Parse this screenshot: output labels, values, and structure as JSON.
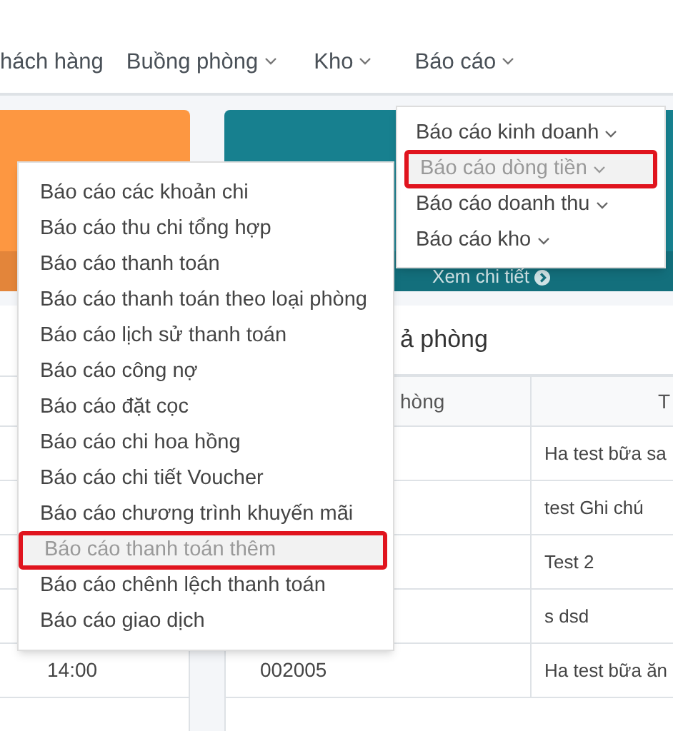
{
  "nav": [
    {
      "label": "hách hàng",
      "dropdown": false
    },
    {
      "label": "Buồng phòng",
      "dropdown": true
    },
    {
      "label": "Kho",
      "dropdown": true
    },
    {
      "label": "Báo cáo",
      "dropdown": true
    }
  ],
  "cards": {
    "link": "Xem chi tiết"
  },
  "left_table": {
    "cell": "14:00"
  },
  "right_table": {
    "title": "ả phòng",
    "columns": [
      "hòng",
      "T"
    ],
    "rows": [
      {
        "note": "Ha test bữa sa"
      },
      {
        "note": "test Ghi chú"
      },
      {
        "note": "Test 2"
      },
      {
        "note": "s dsd"
      },
      {
        "code": "002005",
        "note": "Ha test bữa ăn"
      }
    ]
  },
  "report_menu": [
    {
      "label": "Báo cáo kinh doanh",
      "selected": false
    },
    {
      "label": "Báo cáo dòng tiền",
      "selected": true
    },
    {
      "label": "Báo cáo doanh thu",
      "selected": false
    },
    {
      "label": "Báo cáo kho",
      "selected": false
    }
  ],
  "cashflow_menu": [
    {
      "label": "Báo cáo các khoản chi",
      "selected": false
    },
    {
      "label": "Báo cáo thu chi tổng hợp",
      "selected": false
    },
    {
      "label": "Báo cáo thanh toán",
      "selected": false
    },
    {
      "label": "Báo cáo thanh toán theo loại phòng",
      "selected": false
    },
    {
      "label": "Báo cáo lịch sử thanh toán",
      "selected": false
    },
    {
      "label": "Báo cáo công nợ",
      "selected": false
    },
    {
      "label": "Báo cáo đặt cọc",
      "selected": false
    },
    {
      "label": "Báo cáo chi hoa hồng",
      "selected": false
    },
    {
      "label": "Báo cáo chi tiết Voucher",
      "selected": false
    },
    {
      "label": "Báo cáo chương trình khuyến mãi",
      "selected": false
    },
    {
      "label": "Báo cáo thanh toán thêm",
      "selected": true
    },
    {
      "label": "Báo cáo chênh lệch thanh toán",
      "selected": false
    },
    {
      "label": "Báo cáo giao dịch",
      "selected": false
    }
  ]
}
